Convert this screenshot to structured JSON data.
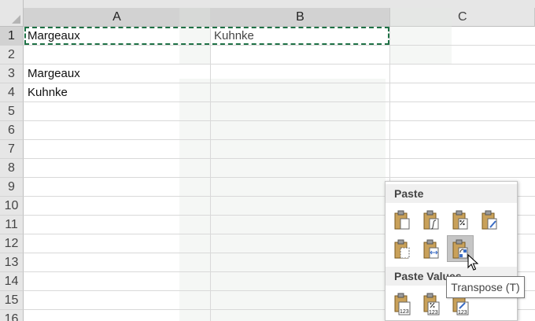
{
  "columns": [
    "A",
    "B",
    "C"
  ],
  "rows": [
    "1",
    "2",
    "3",
    "4",
    "5",
    "6",
    "7",
    "8",
    "9",
    "10",
    "11",
    "12",
    "13",
    "14",
    "15",
    "16"
  ],
  "cells": {
    "A1": "Margeaux",
    "B1": "Kuhnke",
    "A3": "Margeaux",
    "A4": "Kuhnke"
  },
  "paste_menu": {
    "section_paste": "Paste",
    "section_paste_values": "Paste Values",
    "paste_icons": [
      "paste-icon",
      "paste-formulas-icon",
      "paste-formulas-number-formatting-icon",
      "keep-source-formatting-icon",
      "no-borders-icon",
      "keep-source-column-widths-icon",
      "transpose-icon"
    ],
    "values_icons": [
      "paste-values-icon",
      "values-number-formatting-icon",
      "values-source-formatting-icon"
    ]
  },
  "tooltip": "Transpose (T)",
  "colors": {
    "header_bg": "#e6e6e6",
    "selected_header_bg": "#d2d2d2",
    "gridline": "#d9d9d9",
    "copy_marquee": "#1e7145",
    "clipboard_body": "#c9a15a",
    "tooltip_border": "#767676"
  }
}
